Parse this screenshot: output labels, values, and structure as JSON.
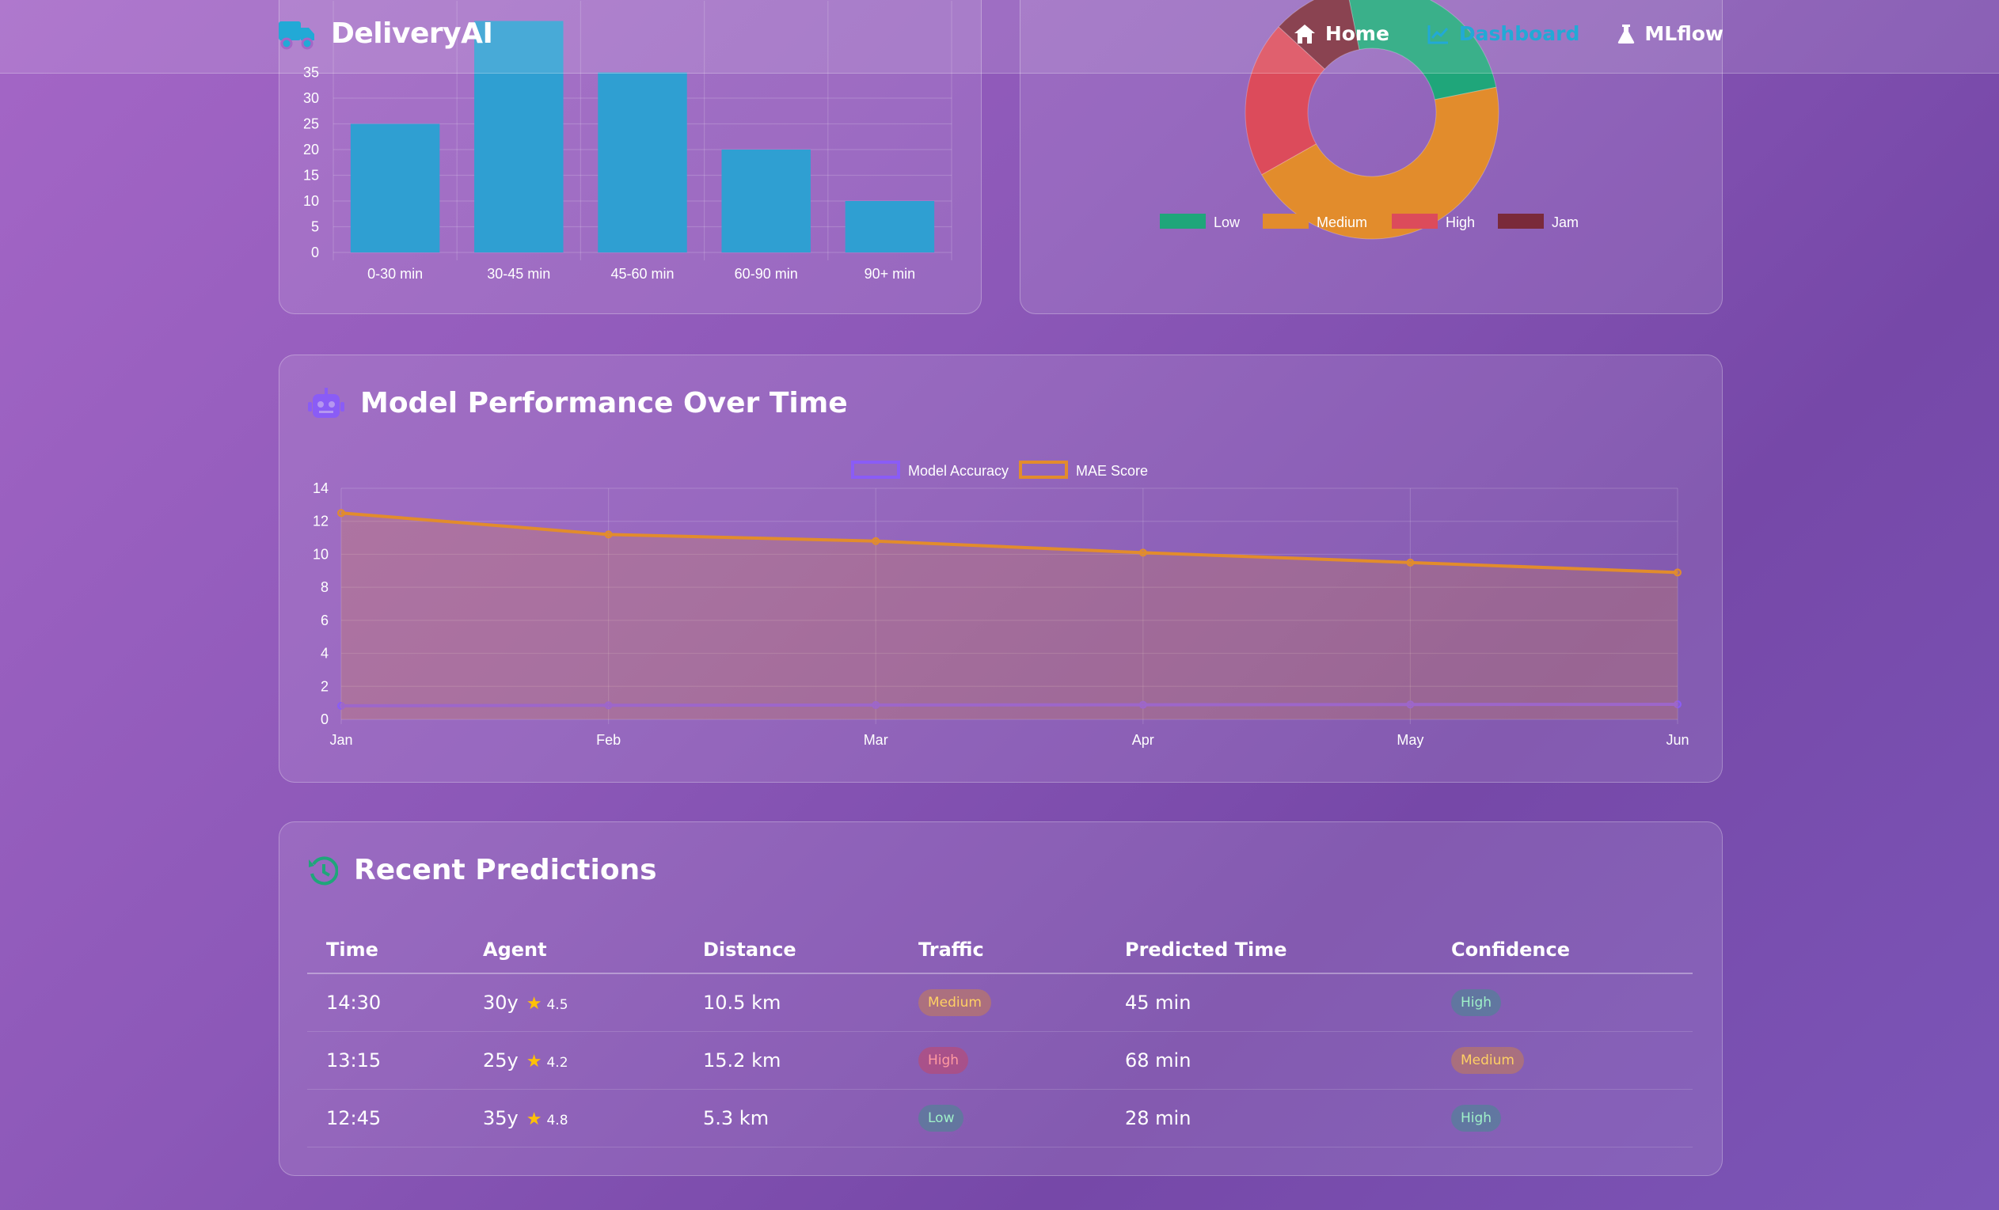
{
  "navbar": {
    "brand": "DeliveryAI",
    "links": [
      {
        "label": "Home",
        "icon": "home-icon"
      },
      {
        "label": "Dashboard",
        "icon": "chart-line-icon",
        "active": true
      },
      {
        "label": "MLflow",
        "icon": "flask-icon"
      }
    ]
  },
  "colors": {
    "accent_blue": "#22a9d6",
    "green": "#1fa67a",
    "orange": "#e28c2c",
    "red": "#dc4b5b",
    "dark_red": "#7a2a3a",
    "purple": "#8a5cf6"
  },
  "delivery_time_chart": {
    "chart_data": {
      "type": "bar",
      "categories": [
        "0-30 min",
        "30-45 min",
        "45-60 min",
        "60-90 min",
        "90+ min"
      ],
      "values": [
        25,
        45,
        35,
        20,
        10
      ],
      "y_ticks": [
        0,
        5,
        10,
        15,
        20,
        25,
        30
      ],
      "ylim": [
        0,
        35
      ],
      "grid": true,
      "color": "#2f9fd2"
    }
  },
  "traffic_chart": {
    "chart_data": {
      "type": "pie",
      "variant": "doughnut",
      "labels": [
        "Low",
        "Medium",
        "High",
        "Jam"
      ],
      "values": [
        25,
        45,
        20,
        10
      ],
      "colors": [
        "#1fa67a",
        "#e28c2c",
        "#dc4b5b",
        "#7a2a3a"
      ],
      "legend": "bottom"
    }
  },
  "performance_card": {
    "title": "Model Performance Over Time",
    "chart_data": {
      "type": "line",
      "x": [
        "Jan",
        "Feb",
        "Mar",
        "Apr",
        "May",
        "Jun"
      ],
      "series": [
        {
          "name": "Model Accuracy",
          "values": [
            0.82,
            0.85,
            0.87,
            0.88,
            0.9,
            0.91
          ],
          "color": "#8a5cf6"
        },
        {
          "name": "MAE Score",
          "values": [
            12.5,
            11.2,
            10.8,
            10.1,
            9.5,
            8.9
          ],
          "color": "#e28c2c",
          "fill": true
        }
      ],
      "ylim": [
        0,
        14
      ],
      "y_ticks": [
        0,
        2,
        4,
        6,
        8,
        10,
        12,
        14
      ],
      "legend": "top",
      "grid": true
    }
  },
  "predictions_card": {
    "title": "Recent Predictions",
    "columns": [
      "Time",
      "Agent",
      "Distance",
      "Traffic",
      "Predicted Time",
      "Confidence"
    ],
    "rows": [
      {
        "time": "14:30",
        "agent_age": "30y",
        "rating": "4.5",
        "distance": "10.5 km",
        "traffic": "Medium",
        "predicted": "45 min",
        "confidence": "High"
      },
      {
        "time": "13:15",
        "agent_age": "25y",
        "rating": "4.2",
        "distance": "15.2 km",
        "traffic": "High",
        "predicted": "68 min",
        "confidence": "Medium"
      },
      {
        "time": "12:45",
        "agent_age": "35y",
        "rating": "4.8",
        "distance": "5.3 km",
        "traffic": "Low",
        "predicted": "28 min",
        "confidence": "High"
      }
    ]
  }
}
